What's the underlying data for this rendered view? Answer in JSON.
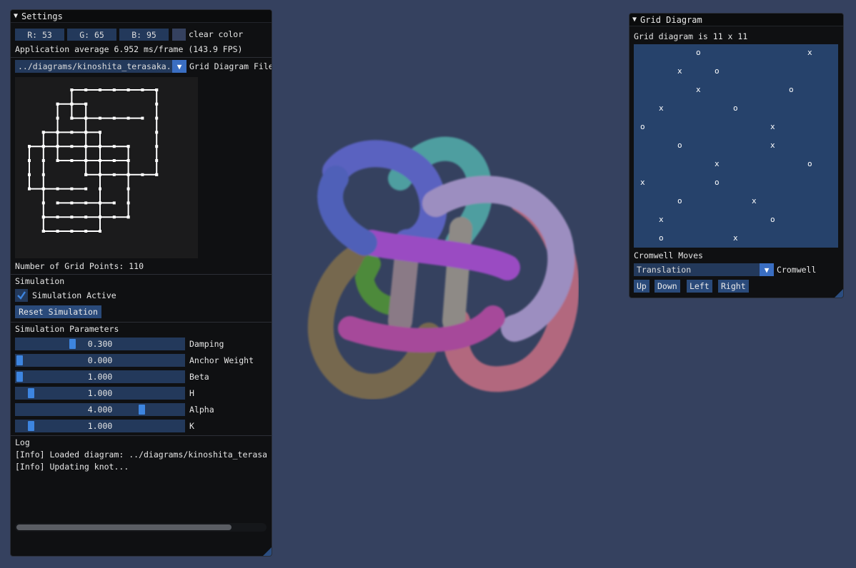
{
  "settings": {
    "title": "Settings",
    "clear_color": {
      "r": "R: 53",
      "g": "G: 65",
      "b": "B: 95",
      "label": "clear color",
      "hex": "#35415f"
    },
    "fps_text": "Application average 6.952 ms/frame (143.9 FPS)",
    "file_combo": {
      "value": "../diagrams/kinoshita_terasaka.",
      "label": "Grid Diagram File"
    },
    "grid_points": "Number of Grid Points: 110",
    "simulation": {
      "header": "Simulation",
      "active_label": "Simulation Active",
      "active": true,
      "reset_label": "Reset Simulation"
    },
    "params_header": "Simulation Parameters",
    "params": [
      {
        "label": "Damping",
        "value": "0.300",
        "level": 0.33
      },
      {
        "label": "Anchor Weight",
        "value": "0.000",
        "level": 0.0
      },
      {
        "label": "Beta",
        "value": "1.000",
        "level": 0.0
      },
      {
        "label": "H",
        "value": "1.000",
        "level": 0.07
      },
      {
        "label": "Alpha",
        "value": "4.000",
        "level": 0.76
      },
      {
        "label": "K",
        "value": "1.000",
        "level": 0.07
      }
    ],
    "log": {
      "header": "Log",
      "lines": [
        "[Info] Loaded diagram: ../diagrams/kinoshita_terasaka",
        "[Info] Updating knot..."
      ]
    },
    "log_scroll_fraction": 0.86
  },
  "grid_window": {
    "title": "Grid Diagram",
    "size_text": "Grid diagram is 11 x 11",
    "n": 11,
    "rows": [
      "...o.....x",
      "..x.o.....",
      "...x....o.",
      ".x...o....",
      "o......x..",
      "..o....x..",
      "....x....o",
      "x...o.....",
      "..o...x...",
      ".x.....o..",
      ".o...x...."
    ],
    "moves_header": "Cromwell Moves",
    "moves_combo": {
      "value": "Translation",
      "label": "Cromwell"
    },
    "move_buttons": [
      "Up",
      "Down",
      "Left",
      "Right"
    ]
  },
  "colors": {
    "accent": "#3d85e0",
    "frame_bg": "#23395b",
    "button": "#2a4a7a",
    "window_bg": "#0f1012",
    "canvas": "#35415f"
  }
}
